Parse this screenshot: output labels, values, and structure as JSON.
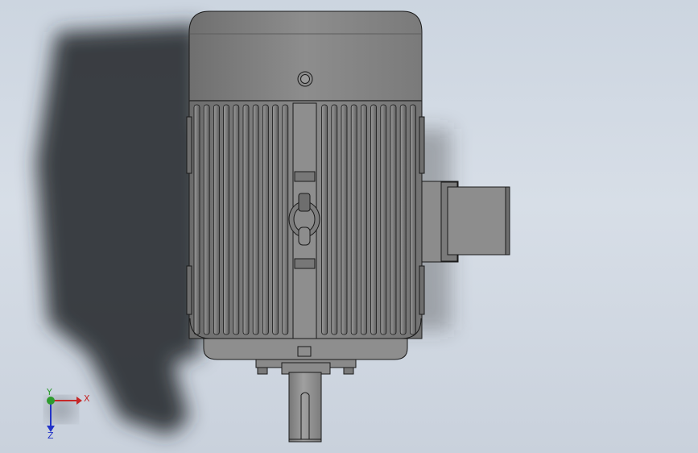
{
  "viewport": {
    "background_top": "#ccd5e0",
    "background_bottom": "#c9d1dc"
  },
  "model": {
    "body_color": "#8a8a8a",
    "shadow_color": "#2a2c30",
    "edge_color": "#1a1a1a"
  },
  "triad": {
    "x_label": "X",
    "y_label": "Y",
    "z_label": "Z",
    "x_color": "#c62828",
    "y_color": "#2e9b2e",
    "z_color": "#2233c8"
  }
}
